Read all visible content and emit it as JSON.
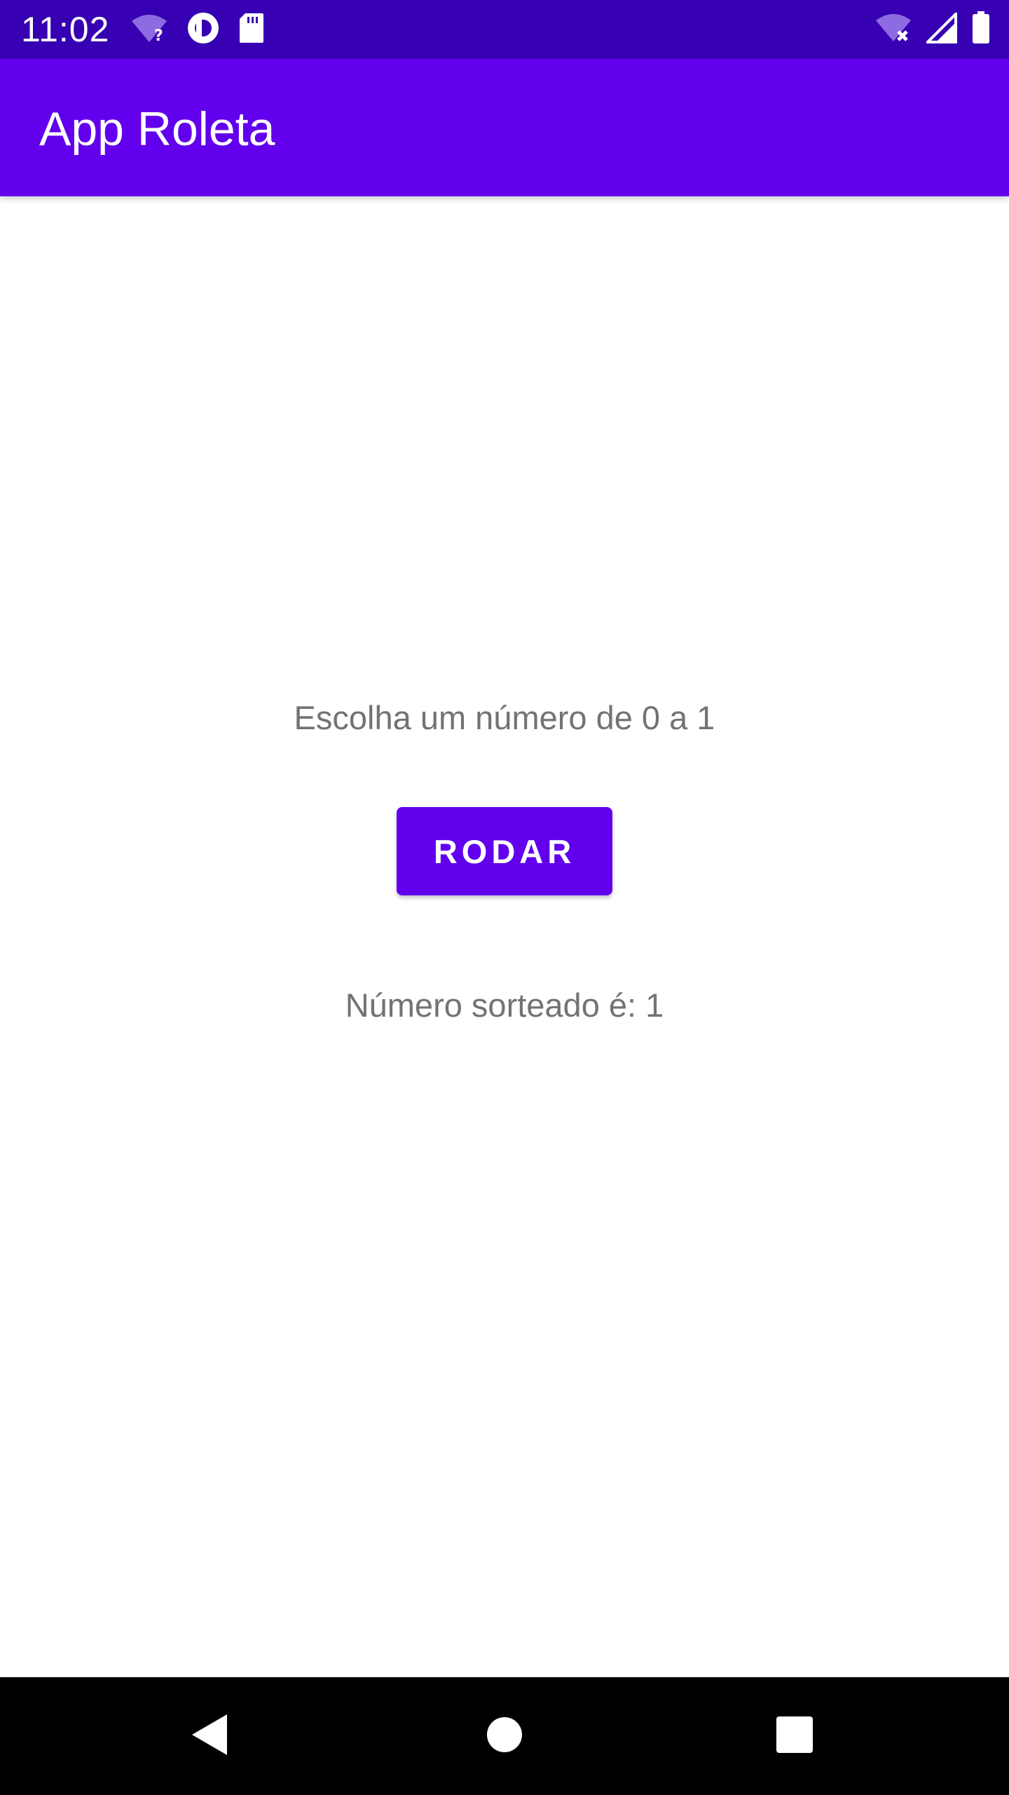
{
  "status_bar": {
    "time": "11:02",
    "left_icons": [
      "wifi-unknown-icon",
      "at-sign-icon",
      "sd-card-icon"
    ],
    "right_icons": [
      "wifi-off-icon",
      "signal-icon",
      "battery-icon"
    ],
    "background": "#3700b3"
  },
  "app_bar": {
    "title": "App Roleta",
    "background": "#6200ee"
  },
  "main": {
    "instruction": "Escolha um número de 0 a 1",
    "spin_button_label": "RODAR",
    "result_text": "Número sorteado é: 1"
  },
  "nav_bar": {
    "buttons": [
      "back-icon",
      "home-icon",
      "recents-icon"
    ]
  },
  "colors": {
    "accent": "#6200ee",
    "accent_dark": "#3700b3",
    "body_text": "#737373"
  }
}
